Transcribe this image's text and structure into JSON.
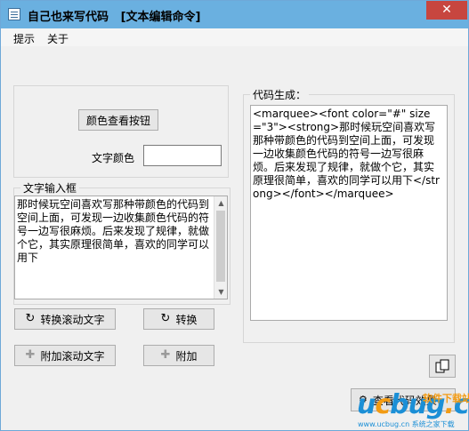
{
  "window": {
    "title": "自己也来写代码   [文本编辑命令]",
    "close_label": "✕"
  },
  "menu": {
    "items": [
      "提示",
      "关于"
    ]
  },
  "color_panel": {
    "view_button_label": "颜色查看按钮",
    "text_color_label": "文字颜色",
    "text_color_value": ""
  },
  "input_box": {
    "label": "文字输入框",
    "text": "那时候玩空间喜欢写那种带颜色的代码到空间上面，可发现一边收集颜色代码的符号一边写很麻烦。后来发现了规律，就做个它，其实原理很简单，喜欢的同学可以用下"
  },
  "actions": {
    "convert_scroll_label": "转换滚动文字",
    "convert_label": "转换",
    "append_scroll_label": "附加滚动文字",
    "append_label": "附加"
  },
  "code_output": {
    "label": "代码生成：",
    "text": "<marquee><font color=\"#\" size=\"3\"><strong>那时候玩空间喜欢写那种带颜色的代码到空间上面，可发现一边收集颜色代码的符号一边写很麻烦。后来发现了规律，就做个它，其实原理很简单，喜欢的同学可以用下</strong></font></marquee>"
  },
  "icons": {
    "refresh": "refresh-icon",
    "plus": "plus-icon",
    "copy": "copy-icon"
  },
  "bottom_button_label": "查看代码效果",
  "watermark": {
    "logo_u": "u",
    "logo_c": "c",
    "logo_rest": "bug",
    "logo_dot": ".",
    "logo_cn": "cn",
    "tagline": "软件下载站",
    "sub": "www.ucbug.cn 系统之家下载"
  },
  "colors": {
    "title_bar": "#6ab0e0",
    "close_button": "#c7463f",
    "window_bg": "#f0f0f0"
  }
}
